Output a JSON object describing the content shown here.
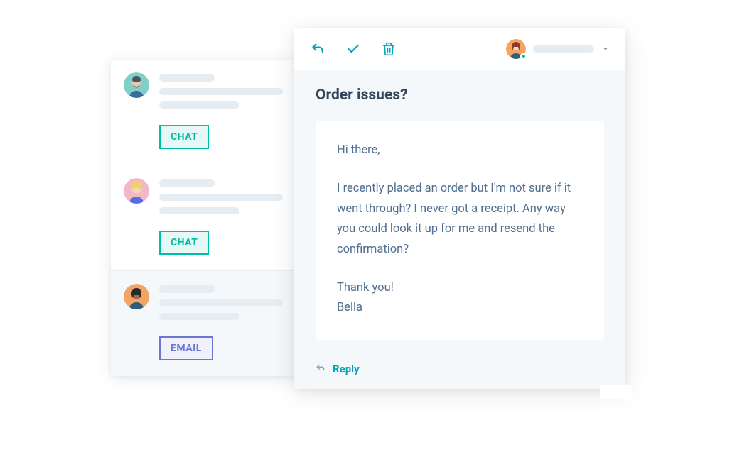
{
  "conversations": [
    {
      "channel_label": "CHAT",
      "channel_type": "chat",
      "avatar_bg": "#7fd1c7",
      "selected": false
    },
    {
      "channel_label": "CHAT",
      "channel_type": "chat",
      "avatar_bg": "#f2b8c6",
      "selected": false
    },
    {
      "channel_label": "EMAIL",
      "channel_type": "email",
      "avatar_bg": "#f5a361",
      "selected": true
    }
  ],
  "message": {
    "subject": "Order issues?",
    "greeting": "Hi there,",
    "body": "I recently placed an order but I'm not sure if it went through? I never got a receipt. Any way you could look it up for me and resend the confirmation?",
    "closing": "Thank you!",
    "sender": "Bella"
  },
  "reply": {
    "label": "Reply"
  },
  "toolbar": {
    "reply_icon": "reply-arrow",
    "check_icon": "checkmark",
    "trash_icon": "trash"
  }
}
